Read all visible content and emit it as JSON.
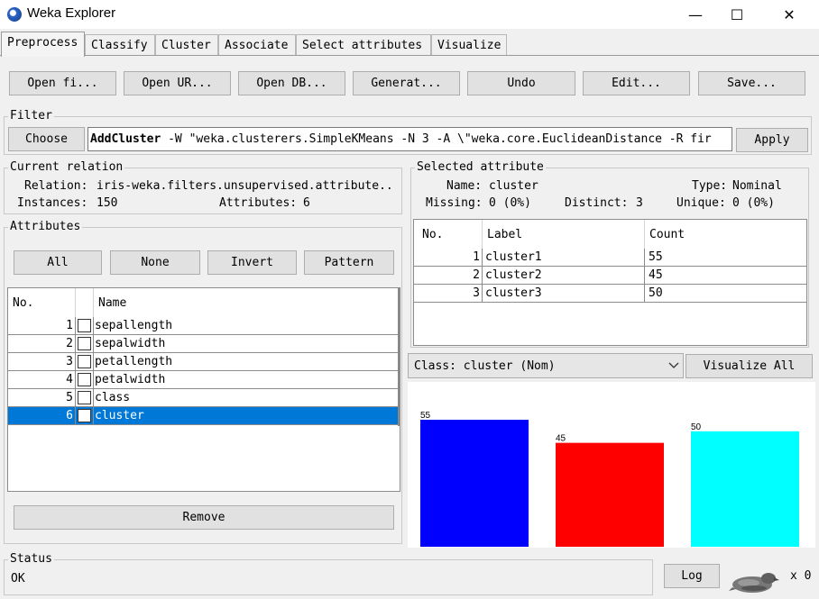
{
  "window": {
    "title": "Weka Explorer",
    "minimize": "—",
    "maximize": "☐",
    "close": "✕"
  },
  "tabs": [
    {
      "label": "Preprocess"
    },
    {
      "label": "Classify"
    },
    {
      "label": "Cluster"
    },
    {
      "label": "Associate"
    },
    {
      "label": "Select attributes"
    },
    {
      "label": "Visualize"
    }
  ],
  "toolbar": {
    "open_file": "Open fi...",
    "open_url": "Open UR...",
    "open_db": "Open DB...",
    "generate": "Generat...",
    "undo": "Undo",
    "edit": "Edit...",
    "save": "Save..."
  },
  "filter": {
    "legend": "Filter",
    "choose": "Choose",
    "name": "AddCluster",
    "options": " -W \"weka.clusterers.SimpleKMeans -N 3 -A \\\"weka.core.EuclideanDistance -R fir",
    "apply": "Apply"
  },
  "current_relation": {
    "legend": "Current relation",
    "relation_label": "Relation:",
    "relation_value": "iris-weka.filters.unsupervised.attribute..",
    "instances_label": "Instances:",
    "instances_value": "150",
    "attributes_label": "Attributes:",
    "attributes_value": "6"
  },
  "attributes": {
    "legend": "Attributes",
    "all": "All",
    "none": "None",
    "invert": "Invert",
    "pattern": "Pattern",
    "col_no": "No.",
    "col_name": "Name",
    "rows": [
      {
        "no": "1",
        "name": "sepallength"
      },
      {
        "no": "2",
        "name": "sepalwidth"
      },
      {
        "no": "3",
        "name": "petallength"
      },
      {
        "no": "4",
        "name": "petalwidth"
      },
      {
        "no": "5",
        "name": "class"
      },
      {
        "no": "6",
        "name": "cluster"
      }
    ],
    "remove": "Remove"
  },
  "selected_attribute": {
    "legend": "Selected attribute",
    "name_label": "Name:",
    "name_value": "cluster",
    "type_label": "Type:",
    "type_value": "Nominal",
    "missing_label": "Missing:",
    "missing_value": "0 (0%)",
    "distinct_label": "Distinct:",
    "distinct_value": "3",
    "unique_label": "Unique:",
    "unique_value": "0 (0%)",
    "col_no": "No.",
    "col_label": "Label",
    "col_count": "Count",
    "rows": [
      {
        "no": "1",
        "label": "cluster1",
        "count": "55"
      },
      {
        "no": "2",
        "label": "cluster2",
        "count": "45"
      },
      {
        "no": "3",
        "label": "cluster3",
        "count": "50"
      }
    ]
  },
  "class_select": {
    "value": "Class: cluster (Nom)",
    "visualize_all": "Visualize All"
  },
  "chart_data": {
    "type": "bar",
    "categories": [
      "cluster1",
      "cluster2",
      "cluster3"
    ],
    "values": [
      55,
      45,
      50
    ],
    "colors": [
      "#0000ff",
      "#ff0000",
      "#00ffff"
    ],
    "ylim": [
      0,
      55
    ]
  },
  "status": {
    "legend": "Status",
    "text": "OK",
    "log": "Log",
    "count": "x 0"
  }
}
